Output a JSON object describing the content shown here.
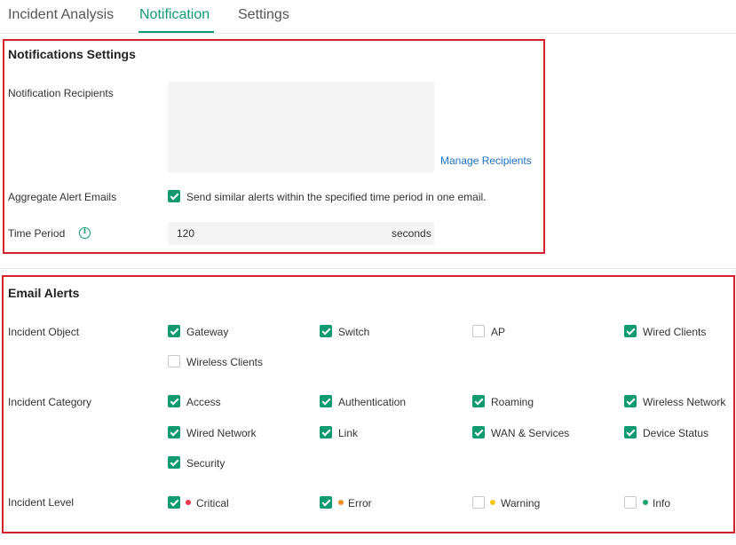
{
  "tabs": [
    {
      "label": "Incident Analysis"
    },
    {
      "label": "Notification"
    },
    {
      "label": "Settings"
    }
  ],
  "notifications": {
    "title": "Notifications Settings",
    "recipients_label": "Notification Recipients",
    "manage_link": "Manage Recipients",
    "aggregate_label": "Aggregate Alert Emails",
    "aggregate_text": "Send similar alerts within the specified time period in one email.",
    "aggregate_checked": true,
    "time_label": "Time Period",
    "time_value": "120",
    "time_unit": "seconds"
  },
  "email_alerts": {
    "title": "Email Alerts",
    "object_label": "Incident Object",
    "category_label": "Incident Category",
    "level_label": "Incident Level",
    "objects": [
      {
        "label": "Gateway",
        "checked": true
      },
      {
        "label": "Switch",
        "checked": true
      },
      {
        "label": "AP",
        "checked": false
      },
      {
        "label": "Wired Clients",
        "checked": true
      },
      {
        "label": "Wireless Clients",
        "checked": false
      }
    ],
    "categories": [
      {
        "label": "Access",
        "checked": true
      },
      {
        "label": "Authentication",
        "checked": true
      },
      {
        "label": "Roaming",
        "checked": true
      },
      {
        "label": "Wireless Network",
        "checked": true
      },
      {
        "label": "Wired Network",
        "checked": true
      },
      {
        "label": "Link",
        "checked": true
      },
      {
        "label": "WAN & Services",
        "checked": true
      },
      {
        "label": "Device Status",
        "checked": true
      },
      {
        "label": "Security",
        "checked": true
      }
    ],
    "levels": [
      {
        "label": "Critical",
        "checked": true,
        "color": "#e8364f"
      },
      {
        "label": "Error",
        "checked": true,
        "color": "#f08c2a"
      },
      {
        "label": "Warning",
        "checked": false,
        "color": "#f5c518"
      },
      {
        "label": "Info",
        "checked": false,
        "color": "#1aa36c"
      }
    ]
  },
  "colors": {
    "accent": "#0f9a72",
    "highlight_border": "#d6202a",
    "link": "#1b72c4"
  }
}
